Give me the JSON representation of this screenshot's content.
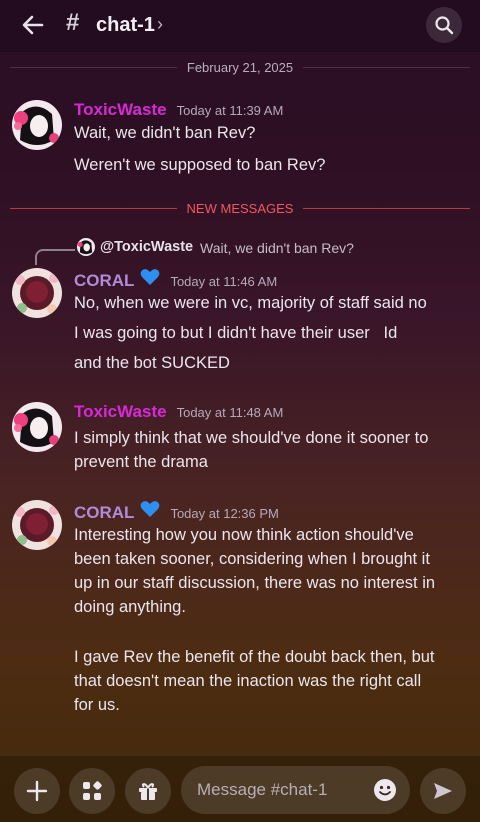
{
  "header": {
    "hash": "#",
    "channel": "chat-1",
    "chevron": "›",
    "back_icon": "arrow-left-icon",
    "search_icon": "search-icon"
  },
  "date_divider": "February 21, 2025",
  "new_divider": "NEW MESSAGES",
  "messages": [
    {
      "user": "ToxicWaste",
      "time": "Today at 11:39 AM",
      "lines": [
        "Wait, we didn't ban Rev?",
        "Weren't we supposed to ban Rev?"
      ]
    },
    {
      "reply_user": "@ToxicWaste",
      "reply_text": "Wait, we didn't ban Rev?",
      "user": "CORAL",
      "time": "Today at 11:46 AM",
      "lines": [
        "No, when we were in vc, majority of staff said no",
        "I was going to but I didn't have their user   Id",
        "and the bot SUCKED"
      ]
    },
    {
      "user": "ToxicWaste",
      "time": "Today at 11:48 AM",
      "lines": [
        "I simply think that we should've done it sooner to",
        "prevent the drama"
      ]
    },
    {
      "user": "CORAL",
      "time": "Today at 12:36 PM",
      "lines": [
        "Interesting how you now think action should've",
        "been taken sooner, considering when I brought it",
        "up in our staff discussion, there was no interest in",
        "doing anything.",
        "I gave Rev the benefit of the doubt back then, but",
        "that doesn't mean the inaction was the right call",
        "for us."
      ]
    }
  ],
  "composer": {
    "placeholder": "Message #chat-1"
  },
  "colors": {
    "toxic_name": "#d72ad7",
    "coral_name": "#b28ad8",
    "new_messages": "#ee5a5f",
    "heart": "#2f8ff0"
  }
}
